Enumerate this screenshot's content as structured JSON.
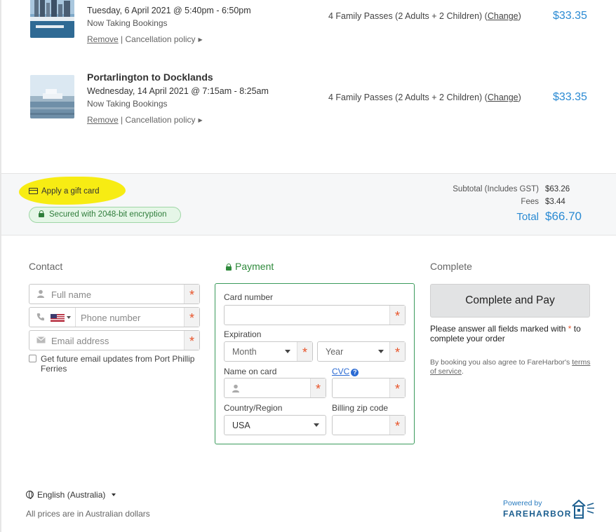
{
  "bookings": [
    {
      "title": "",
      "date": "Tuesday, 6 April 2021 @ 5:40pm - 6:50pm",
      "status": "Now Taking Bookings",
      "remove_label": "Remove",
      "separator": " | ",
      "policy_label": "Cancellation policy",
      "passes": "4 Family Passes (2 Adults + 2 Children)",
      "change_label": "Change",
      "price": "$33.35"
    },
    {
      "title": "Portarlington to Docklands",
      "date": "Wednesday, 14 April 2021 @ 7:15am - 8:25am",
      "status": "Now Taking Bookings",
      "remove_label": "Remove",
      "separator": " | ",
      "policy_label": "Cancellation policy",
      "passes": "4 Family Passes (2 Adults + 2 Children)",
      "change_label": "Change",
      "price": "$33.35"
    }
  ],
  "summary": {
    "gift_card_label": "Apply a gift card",
    "secure_label": "Secured with 2048-bit encryption",
    "subtotal_label": "Subtotal (Includes GST)",
    "subtotal_value": "$63.26",
    "fees_label": "Fees",
    "fees_value": "$3.44",
    "total_label": "Total",
    "total_value": "$66.70"
  },
  "contact": {
    "heading": "Contact",
    "name_placeholder": "Full name",
    "phone_placeholder": "Phone number",
    "email_placeholder": "Email address",
    "required_mark": "*",
    "newsletter_label": "Get future email updates from Port Phillip Ferries"
  },
  "payment": {
    "heading": "Payment",
    "card_number_label": "Card number",
    "expiration_label": "Expiration",
    "month_value": "Month",
    "year_value": "Year",
    "name_on_card_label": "Name on card",
    "cvc_label": "CVC",
    "country_label": "Country/Region",
    "country_value": "USA",
    "zip_label": "Billing zip code",
    "required_mark": "*"
  },
  "complete": {
    "heading": "Complete",
    "button_label": "Complete and Pay",
    "warning_prefix": "Please answer all fields marked with ",
    "warning_star": "*",
    "warning_suffix": " to complete your order",
    "terms_prefix": "By booking you also agree to FareHarbor's ",
    "terms_link": "terms of service",
    "terms_suffix": "."
  },
  "footer": {
    "language": "English (Australia)",
    "currency_note": "All prices are in Australian dollars",
    "powered_by": "Powered by",
    "brand": "FAREHARBOR"
  },
  "colors": {
    "accent_blue": "#2a8ad3",
    "secure_green": "#2f7d3b",
    "required_orange": "#e8542a",
    "highlight_yellow": "#f7ec13"
  }
}
